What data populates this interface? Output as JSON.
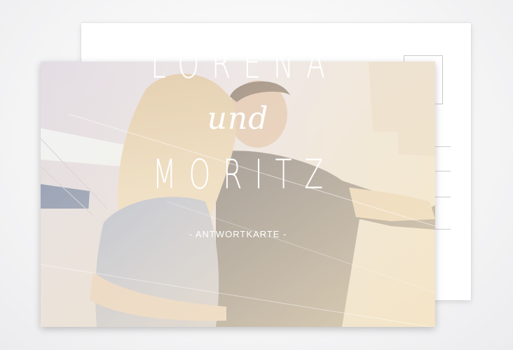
{
  "card": {
    "name_first": "LORENA",
    "connector": "und",
    "name_second": "MORITZ",
    "subtitle": "- ANTWORTKARTE -"
  },
  "colors": {
    "background": "#f3f3f4",
    "text": "#ffffff",
    "photo_tint": "#e8dce8",
    "back_card": "#ffffff"
  }
}
